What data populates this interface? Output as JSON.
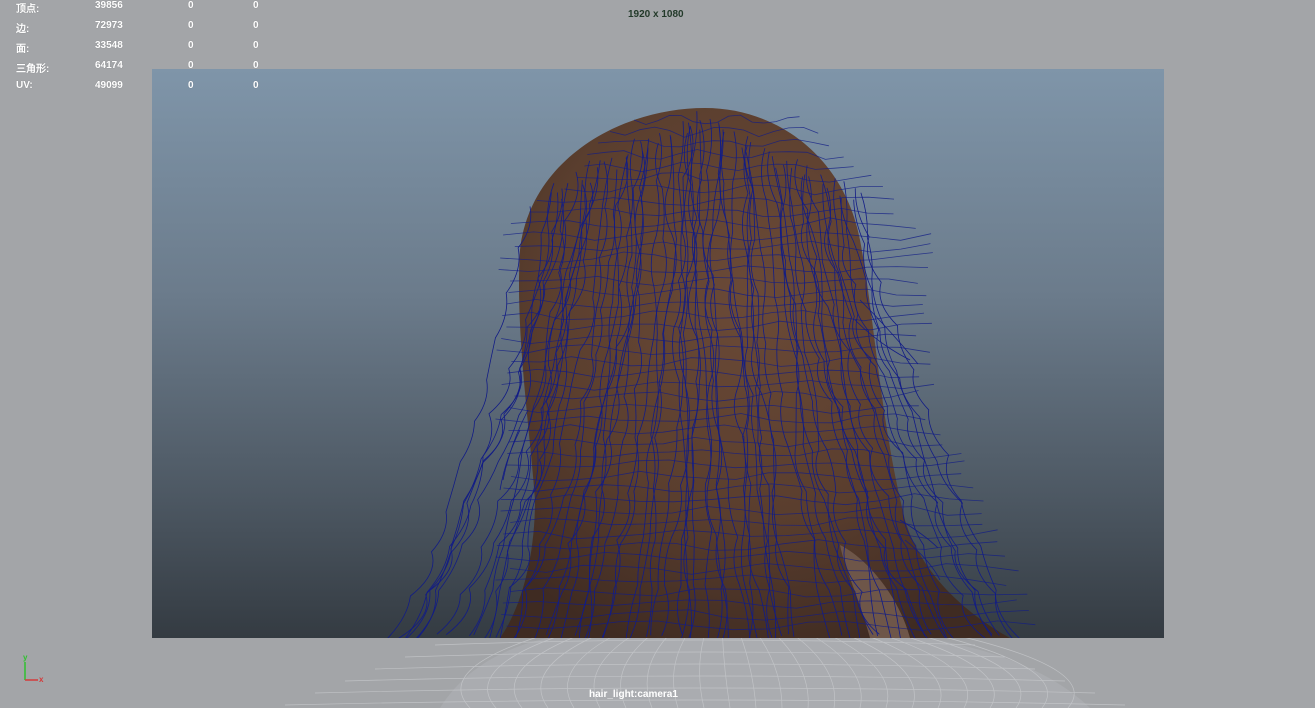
{
  "hud": {
    "rows": [
      {
        "label": "顶点:",
        "v1": "39856",
        "v2": "0",
        "v3": "0"
      },
      {
        "label": "边:",
        "v1": "72973",
        "v2": "0",
        "v3": "0"
      },
      {
        "label": "面:",
        "v1": "33548",
        "v2": "0",
        "v3": "0"
      },
      {
        "label": "三角形:",
        "v1": "64174",
        "v2": "0",
        "v3": "0"
      },
      {
        "label": "UV:",
        "v1": "49099",
        "v2": "0",
        "v3": "0"
      }
    ]
  },
  "resolution_gate": "1920 x 1080",
  "camera_name": "hair_light:camera1",
  "axis": {
    "x": "x",
    "y": "y"
  },
  "colors": {
    "viewport_bg": "#a3a5a8",
    "wireframe": "#121c86",
    "hair_fill": "#5a3e2e",
    "resolution_text": "#233a2a"
  }
}
